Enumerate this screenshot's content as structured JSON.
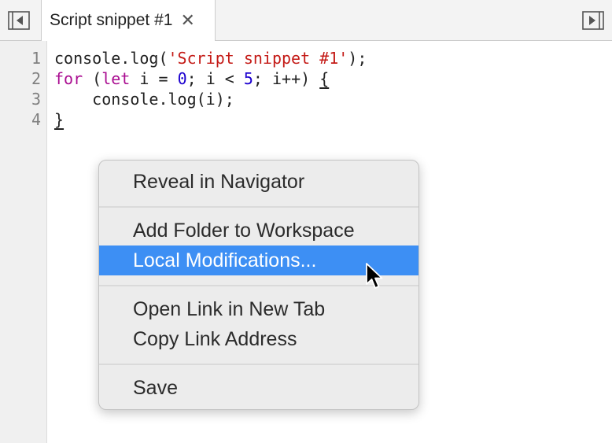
{
  "tab": {
    "title": "Script snippet #1",
    "close_glyph": "✕"
  },
  "icons": {
    "left": "toggle-navigator-icon",
    "right": "toggle-debugger-icon",
    "cursor": "mouse-pointer-icon"
  },
  "colors": {
    "highlight": "#3d8ff4",
    "keyword": "#aa0d91",
    "string": "#c41a16",
    "number": "#1c00cf"
  },
  "code": {
    "line_numbers": [
      "1",
      "2",
      "3",
      "4"
    ],
    "line1": {
      "a": "console.log(",
      "b": "'Script snippet #1'",
      "c": ");"
    },
    "line2": {
      "a": "for",
      "b": " (",
      "c": "let",
      "d": " i = ",
      "e": "0",
      "f": "; i < ",
      "g": "5",
      "h": "; i++) ",
      "i": "{"
    },
    "line3": {
      "a": "    console.log(i);"
    },
    "line4": {
      "a": "}"
    }
  },
  "menu": {
    "items": [
      "Reveal in Navigator",
      "Add Folder to Workspace",
      "Local Modifications...",
      "Open Link in New Tab",
      "Copy Link Address",
      "Save"
    ],
    "highlighted": "Local Modifications..."
  }
}
